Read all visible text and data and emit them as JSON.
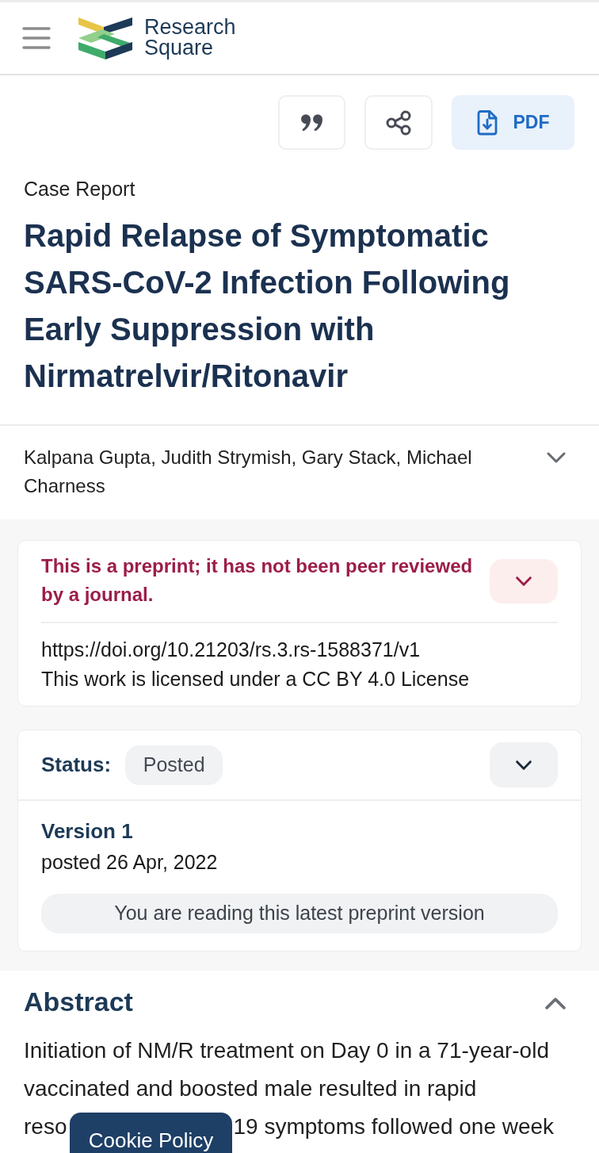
{
  "header": {
    "site_name": "Research Square"
  },
  "toolbar": {
    "buttons": [
      {
        "kind": "cite"
      },
      {
        "kind": "share"
      },
      {
        "kind": "pdf",
        "label": "PDF"
      }
    ]
  },
  "article": {
    "type": "Case Report",
    "title": "Rapid Relapse of Symptomatic SARS-CoV-2 Infection Following Early Suppression with Nirmatrelvir/Ritonavir",
    "authors": "Kalpana Gupta, Judith Strymish, Gary Stack, Michael Charness",
    "authors_expanded": false
  },
  "preprint_notice": {
    "text": "This is a preprint; it has not been peer reviewed by a journal.",
    "expanded": false,
    "doi": "https://doi.org/10.21203/rs.3.rs-1588371/v1",
    "license": "This work is licensed under a CC BY 4.0 License"
  },
  "status_card": {
    "label": "Status:",
    "status": "Posted",
    "expanded": false,
    "version": "Version 1",
    "posted": "posted 26 Apr, 2022",
    "note": "You are reading this latest preprint version"
  },
  "abstract": {
    "heading": "Abstract",
    "expanded": true,
    "text_parts": [
      "Initiation of NM/R treatment on Day 0 in a 71-year-old vaccinated and boosted male resulted in rapid",
      "reso",
      "19 symptoms followed one week"
    ]
  },
  "cookie_button": {
    "label": "Cookie Policy"
  }
}
